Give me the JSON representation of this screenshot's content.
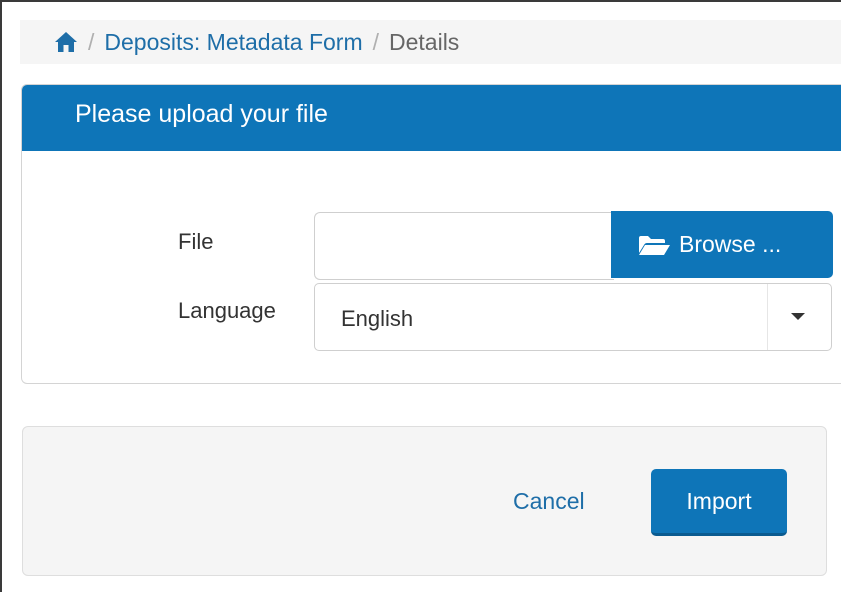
{
  "breadcrumb": {
    "home_icon": "home-icon",
    "separator": "/",
    "items": [
      {
        "label": "Deposits: Metadata Form"
      },
      {
        "label": "Details"
      }
    ]
  },
  "panel": {
    "title": "Please upload your file",
    "file": {
      "label": "File",
      "value": "",
      "browse_label": "Browse ...",
      "browse_icon": "folder-open-icon"
    },
    "language": {
      "label": "Language",
      "selected": "English",
      "caret_icon": "caret-down-icon"
    }
  },
  "footer": {
    "cancel_label": "Cancel",
    "import_label": "Import"
  },
  "colors": {
    "primary": "#0e75b8",
    "link": "#1e6ea8",
    "footer_bg": "#f5f5f5"
  }
}
